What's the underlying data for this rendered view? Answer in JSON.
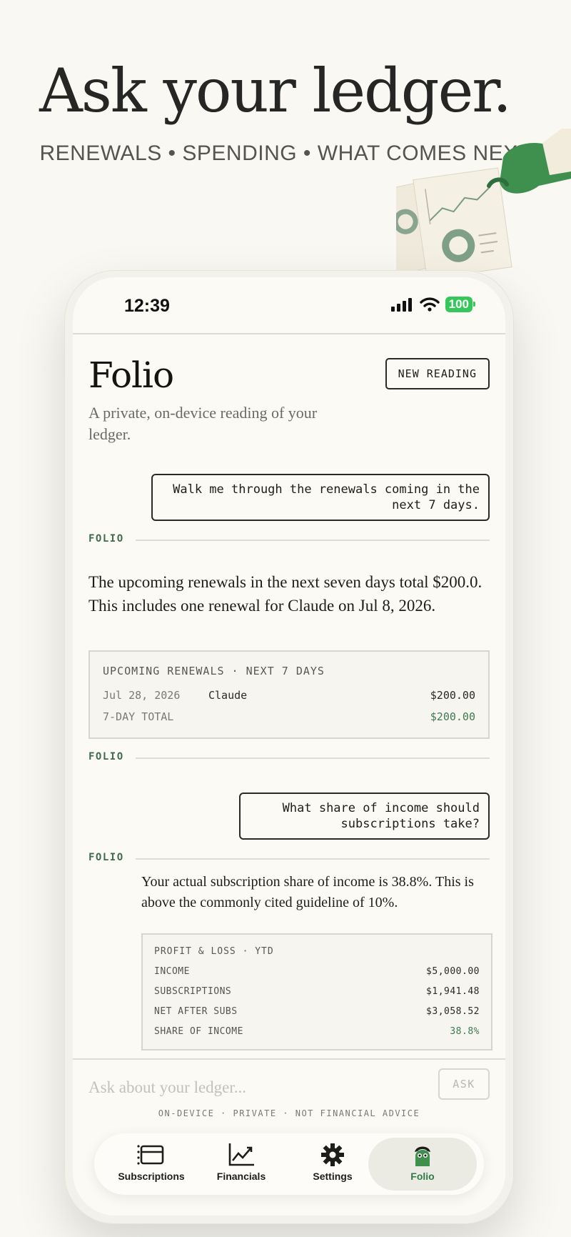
{
  "hero": {
    "headline": "Ask your ledger.",
    "subline": "RENEWALS • SPENDING • WHAT COMES NEXT"
  },
  "status_bar": {
    "time": "12:39",
    "battery": "100"
  },
  "header": {
    "title": "Folio",
    "new_reading_label": "NEW READING",
    "tagline": "A private, on-device reading of your ledger."
  },
  "conversation": {
    "q1": "Walk me through the renewals coming in the next 7 days.",
    "folio_label": "FOLIO",
    "a1": "The upcoming renewals in the next seven days total $200.0. This includes one renewal for Claude on Jul 8, 2026.",
    "renewals_card": {
      "title": "UPCOMING RENEWALS · NEXT 7 DAYS",
      "row": {
        "date": "Jul 28, 2026",
        "name": "Claude",
        "amount": "$200.00"
      },
      "total_label": "7-DAY TOTAL",
      "total_amount": "$200.00"
    },
    "q2": "What share of income should subscriptions take?",
    "a2": "Your actual subscription share of income is 38.8%. This is above the commonly cited guideline of 10%.",
    "pl_card": {
      "title": "PROFIT & LOSS · YTD",
      "rows": [
        {
          "label": "INCOME",
          "value": "$5,000.00"
        },
        {
          "label": "SUBSCRIPTIONS",
          "value": "$1,941.48"
        },
        {
          "label": "NET AFTER SUBS",
          "value": "$3,058.52"
        },
        {
          "label": "SHARE OF INCOME",
          "value": "38.8%"
        }
      ]
    }
  },
  "composer": {
    "placeholder": "Ask about your ledger...",
    "ask_label": "ASK",
    "disclaimer": "ON-DEVICE · PRIVATE · NOT FINANCIAL ADVICE"
  },
  "tabs": [
    {
      "label": "Subscriptions",
      "icon": "subscriptions-icon"
    },
    {
      "label": "Financials",
      "icon": "chart-icon"
    },
    {
      "label": "Settings",
      "icon": "gear-icon"
    },
    {
      "label": "Folio",
      "icon": "folio-mascot-icon",
      "active": true
    }
  ],
  "colors": {
    "accent_green": "#3e7a52",
    "battery_green": "#35c759",
    "background": "#f9f8f2"
  }
}
